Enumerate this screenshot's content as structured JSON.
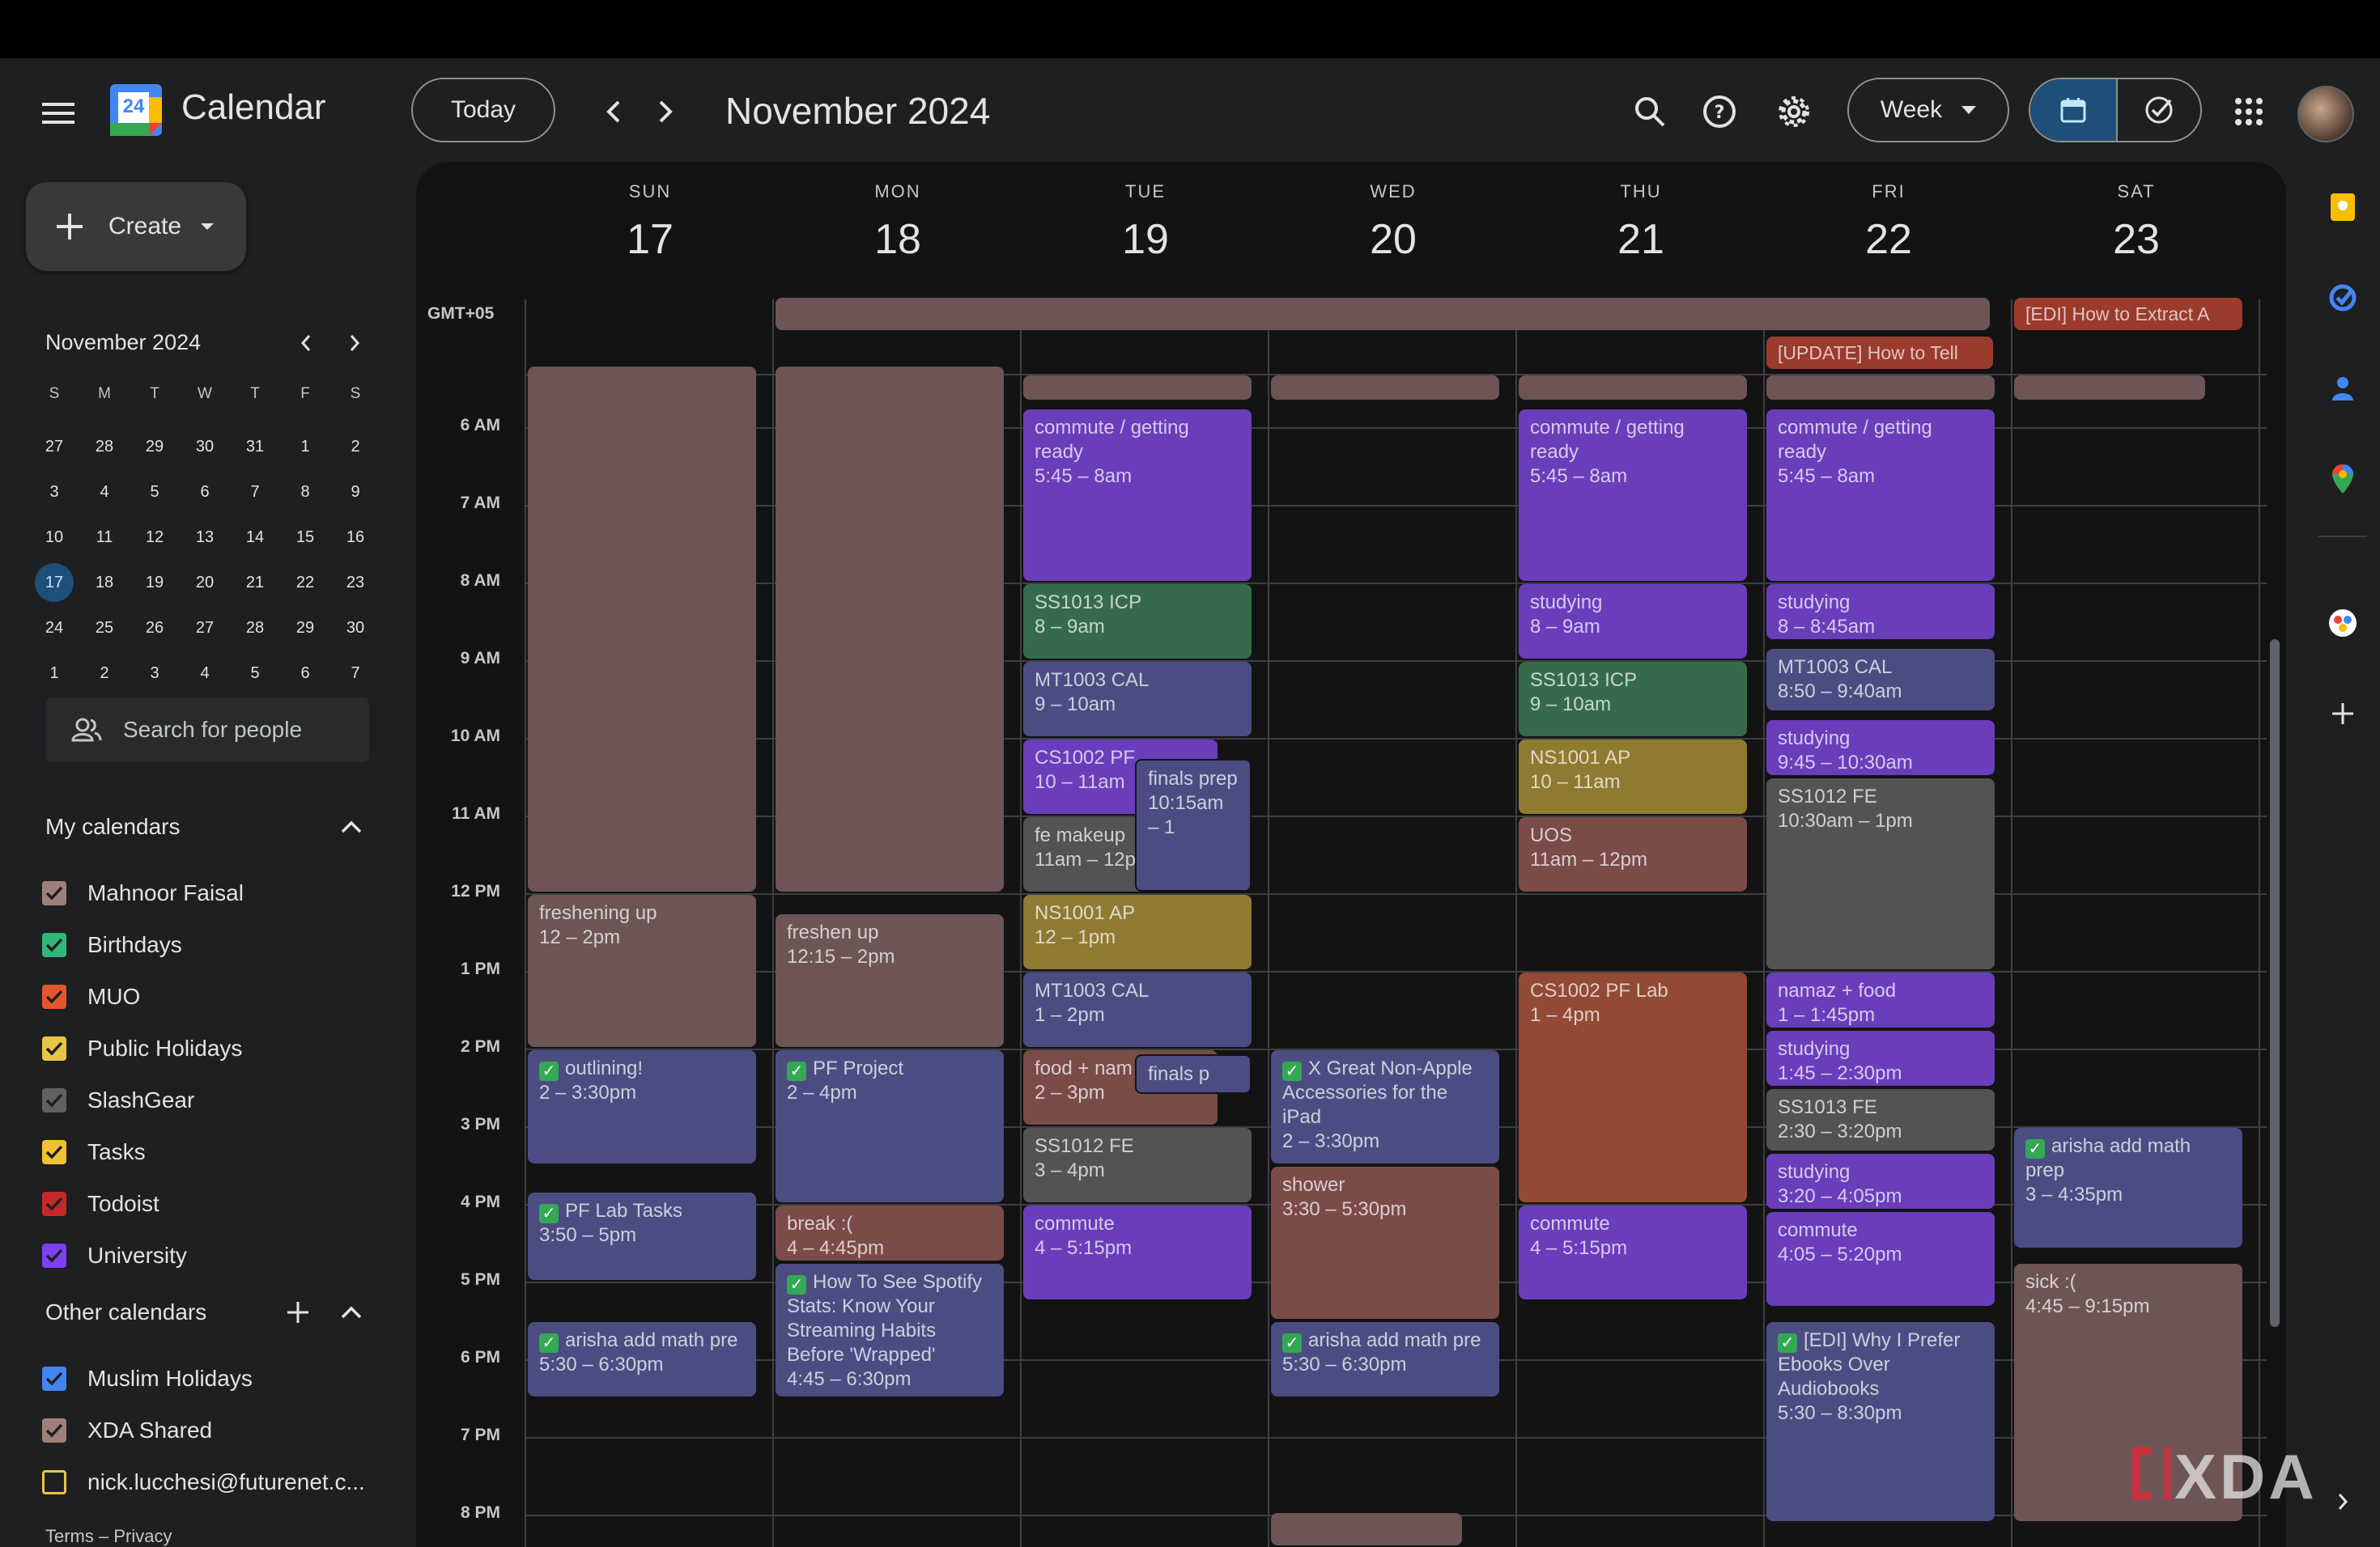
{
  "app": {
    "title": "Calendar",
    "logo_day": "24"
  },
  "header": {
    "today_label": "Today",
    "current_period": "November 2024",
    "view_label": "Week"
  },
  "sidebar": {
    "create_label": "Create",
    "mini_month": "November 2024",
    "dow": [
      "S",
      "M",
      "T",
      "W",
      "T",
      "F",
      "S"
    ],
    "weeks": [
      [
        "27",
        "28",
        "29",
        "30",
        "31",
        "1",
        "2"
      ],
      [
        "3",
        "4",
        "5",
        "6",
        "7",
        "8",
        "9"
      ],
      [
        "10",
        "11",
        "12",
        "13",
        "14",
        "15",
        "16"
      ],
      [
        "17",
        "18",
        "19",
        "20",
        "21",
        "22",
        "23"
      ],
      [
        "24",
        "25",
        "26",
        "27",
        "28",
        "29",
        "30"
      ],
      [
        "1",
        "2",
        "3",
        "4",
        "5",
        "6",
        "7"
      ]
    ],
    "search_people_placeholder": "Search for people",
    "my_calendars_title": "My calendars",
    "my_calendars": [
      {
        "name": "Mahnoor Faisal",
        "color": "#a07f7b"
      },
      {
        "name": "Birthdays",
        "color": "#33b679"
      },
      {
        "name": "MUO",
        "color": "#e4572e"
      },
      {
        "name": "Public Holidays",
        "color": "#e8c547"
      },
      {
        "name": "SlashGear",
        "color": "#616161"
      },
      {
        "name": "Tasks",
        "color": "#f1c232"
      },
      {
        "name": "Todoist",
        "color": "#c62828"
      },
      {
        "name": "University",
        "color": "#7e3ff2"
      }
    ],
    "other_calendars_title": "Other calendars",
    "other_calendars": [
      {
        "name": "Muslim Holidays",
        "color": "#4285f4"
      },
      {
        "name": "XDA Shared",
        "color": "#a07f7b"
      },
      {
        "name": "nick.lucchesi@futurenet.c...",
        "color": "#e8c547"
      }
    ],
    "footer": "Terms – Privacy"
  },
  "week": {
    "timezone": "GMT+05",
    "days": [
      {
        "dow": "SUN",
        "num": "17"
      },
      {
        "dow": "MON",
        "num": "18"
      },
      {
        "dow": "TUE",
        "num": "19"
      },
      {
        "dow": "WED",
        "num": "20"
      },
      {
        "dow": "THU",
        "num": "21"
      },
      {
        "dow": "FRI",
        "num": "22"
      },
      {
        "dow": "SAT",
        "num": "23"
      }
    ],
    "hours": [
      "6 AM",
      "7 AM",
      "8 AM",
      "9 AM",
      "10 AM",
      "11 AM",
      "12 PM",
      "1 PM",
      "2 PM",
      "3 PM",
      "4 PM",
      "5 PM",
      "6 PM",
      "7 PM",
      "8 PM"
    ],
    "allday": [
      {
        "text": "[EDI] How to Extract A"
      },
      {
        "text": "[UPDATE] How to Tell"
      }
    ],
    "events": [
      {
        "title": "freshening up",
        "time": "12 – 2pm"
      },
      {
        "title": "outlining!",
        "time": "2 – 3:30pm",
        "task": true
      },
      {
        "title": "PF Lab Tasks",
        "time": "3:50 – 5pm",
        "task": true
      },
      {
        "title": "arisha add math pre",
        "time": "5:30 – 6:30pm",
        "task": true
      },
      {
        "title": "freshen up",
        "time": "12:15 – 2pm"
      },
      {
        "title": "PF Project",
        "time": "2 – 4pm",
        "task": true
      },
      {
        "title": "break :(",
        "time": "4 – 4:45pm"
      },
      {
        "title": "How To See Spotify Stats: Know Your Streaming Habits Before 'Wrapped'",
        "time": "4:45 – 6:30pm",
        "task": true
      },
      {
        "title": "commute / getting ready",
        "time": "5:45 – 8am"
      },
      {
        "title": "SS1013 ICP",
        "time": "8 – 9am"
      },
      {
        "title": "MT1003 CAL",
        "time": "9 – 10am"
      },
      {
        "title": "CS1002 PF",
        "time": "10 – 11am"
      },
      {
        "title": "finals prep",
        "time": "10:15am – 1"
      },
      {
        "title": "fe makeup",
        "time": "11am – 12p"
      },
      {
        "title": "NS1001 AP",
        "time": "12 – 1pm"
      },
      {
        "title": "MT1003 CAL",
        "time": "1 – 2pm"
      },
      {
        "title": "food + nam",
        "time": "2 – 3pm"
      },
      {
        "title": "finals p",
        "time": ""
      },
      {
        "title": "SS1012 FE",
        "time": "3 – 4pm"
      },
      {
        "title": "commute",
        "time": "4 – 5:15pm"
      },
      {
        "title": "X Great Non-Apple Accessories for the iPad",
        "time": "2 – 3:30pm",
        "task": true
      },
      {
        "title": "shower",
        "time": "3:30 – 5:30pm"
      },
      {
        "title": "arisha add math pre",
        "time": "5:30 – 6:30pm",
        "task": true
      },
      {
        "title": "commute / getting ready",
        "time": "5:45 – 8am"
      },
      {
        "title": "studying",
        "time": "8 – 9am"
      },
      {
        "title": "SS1013 ICP",
        "time": "9 – 10am"
      },
      {
        "title": "NS1001 AP",
        "time": "10 – 11am"
      },
      {
        "title": "UOS",
        "time": "11am – 12pm"
      },
      {
        "title": "CS1002 PF Lab",
        "time": "1 – 4pm"
      },
      {
        "title": "commute",
        "time": "4 – 5:15pm"
      },
      {
        "title": "commute / getting ready",
        "time": "5:45 – 8am"
      },
      {
        "title": "studying",
        "time": "8 – 8:45am"
      },
      {
        "title": "MT1003 CAL",
        "time": "8:50 – 9:40am"
      },
      {
        "title": "studying",
        "time": "9:45 – 10:30am"
      },
      {
        "title": "SS1012 FE",
        "time": "10:30am – 1pm"
      },
      {
        "title": "namaz + food",
        "time": "1 – 1:45pm"
      },
      {
        "title": "studying",
        "time": "1:45 – 2:30pm"
      },
      {
        "title": "SS1013 FE",
        "time": "2:30 – 3:20pm"
      },
      {
        "title": "studying",
        "time": "3:20 – 4:05pm"
      },
      {
        "title": "commute",
        "time": "4:05 – 5:20pm"
      },
      {
        "title": "[EDI] Why I Prefer Ebooks Over Audiobooks",
        "time": "5:30 – 8:30pm",
        "task": true
      },
      {
        "title": "arisha add math prep",
        "time": "3 – 4:35pm",
        "task": true
      },
      {
        "title": "sick :(",
        "time": "4:45 – 9:15pm"
      }
    ]
  },
  "watermark": "XDA"
}
